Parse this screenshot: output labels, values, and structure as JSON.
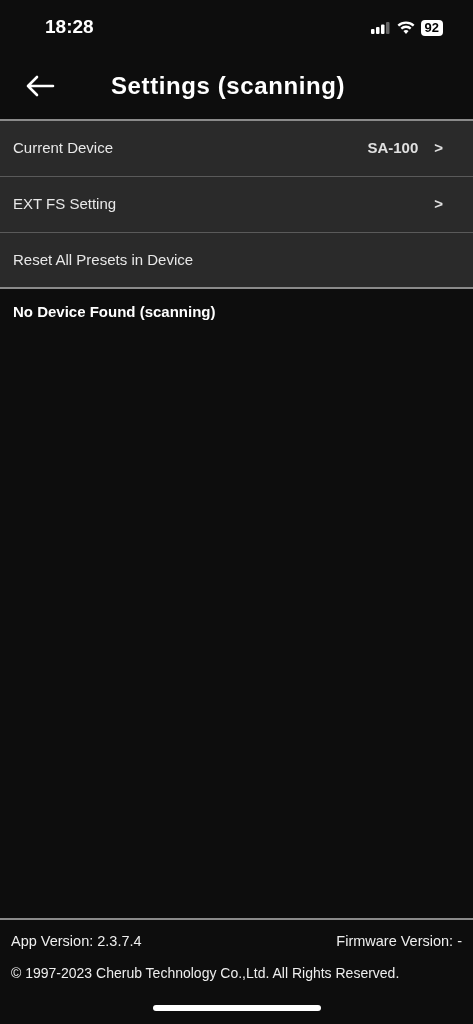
{
  "status_bar": {
    "time": "18:28",
    "battery": "92"
  },
  "header": {
    "title": "Settings (scanning)"
  },
  "menu": [
    {
      "label": "Current Device",
      "value": "SA-100",
      "chevron": ">"
    },
    {
      "label": "EXT FS Setting",
      "chevron": ">"
    },
    {
      "label": "Reset All Presets in Device"
    }
  ],
  "status_message": "No Device Found (scanning)",
  "footer": {
    "app_version": "App Version: 2.3.7.4",
    "firmware_version": "Firmware Version: -",
    "copyright": "© 1997-2023 Cherub Technology Co.,Ltd. All Rights Reserved."
  }
}
